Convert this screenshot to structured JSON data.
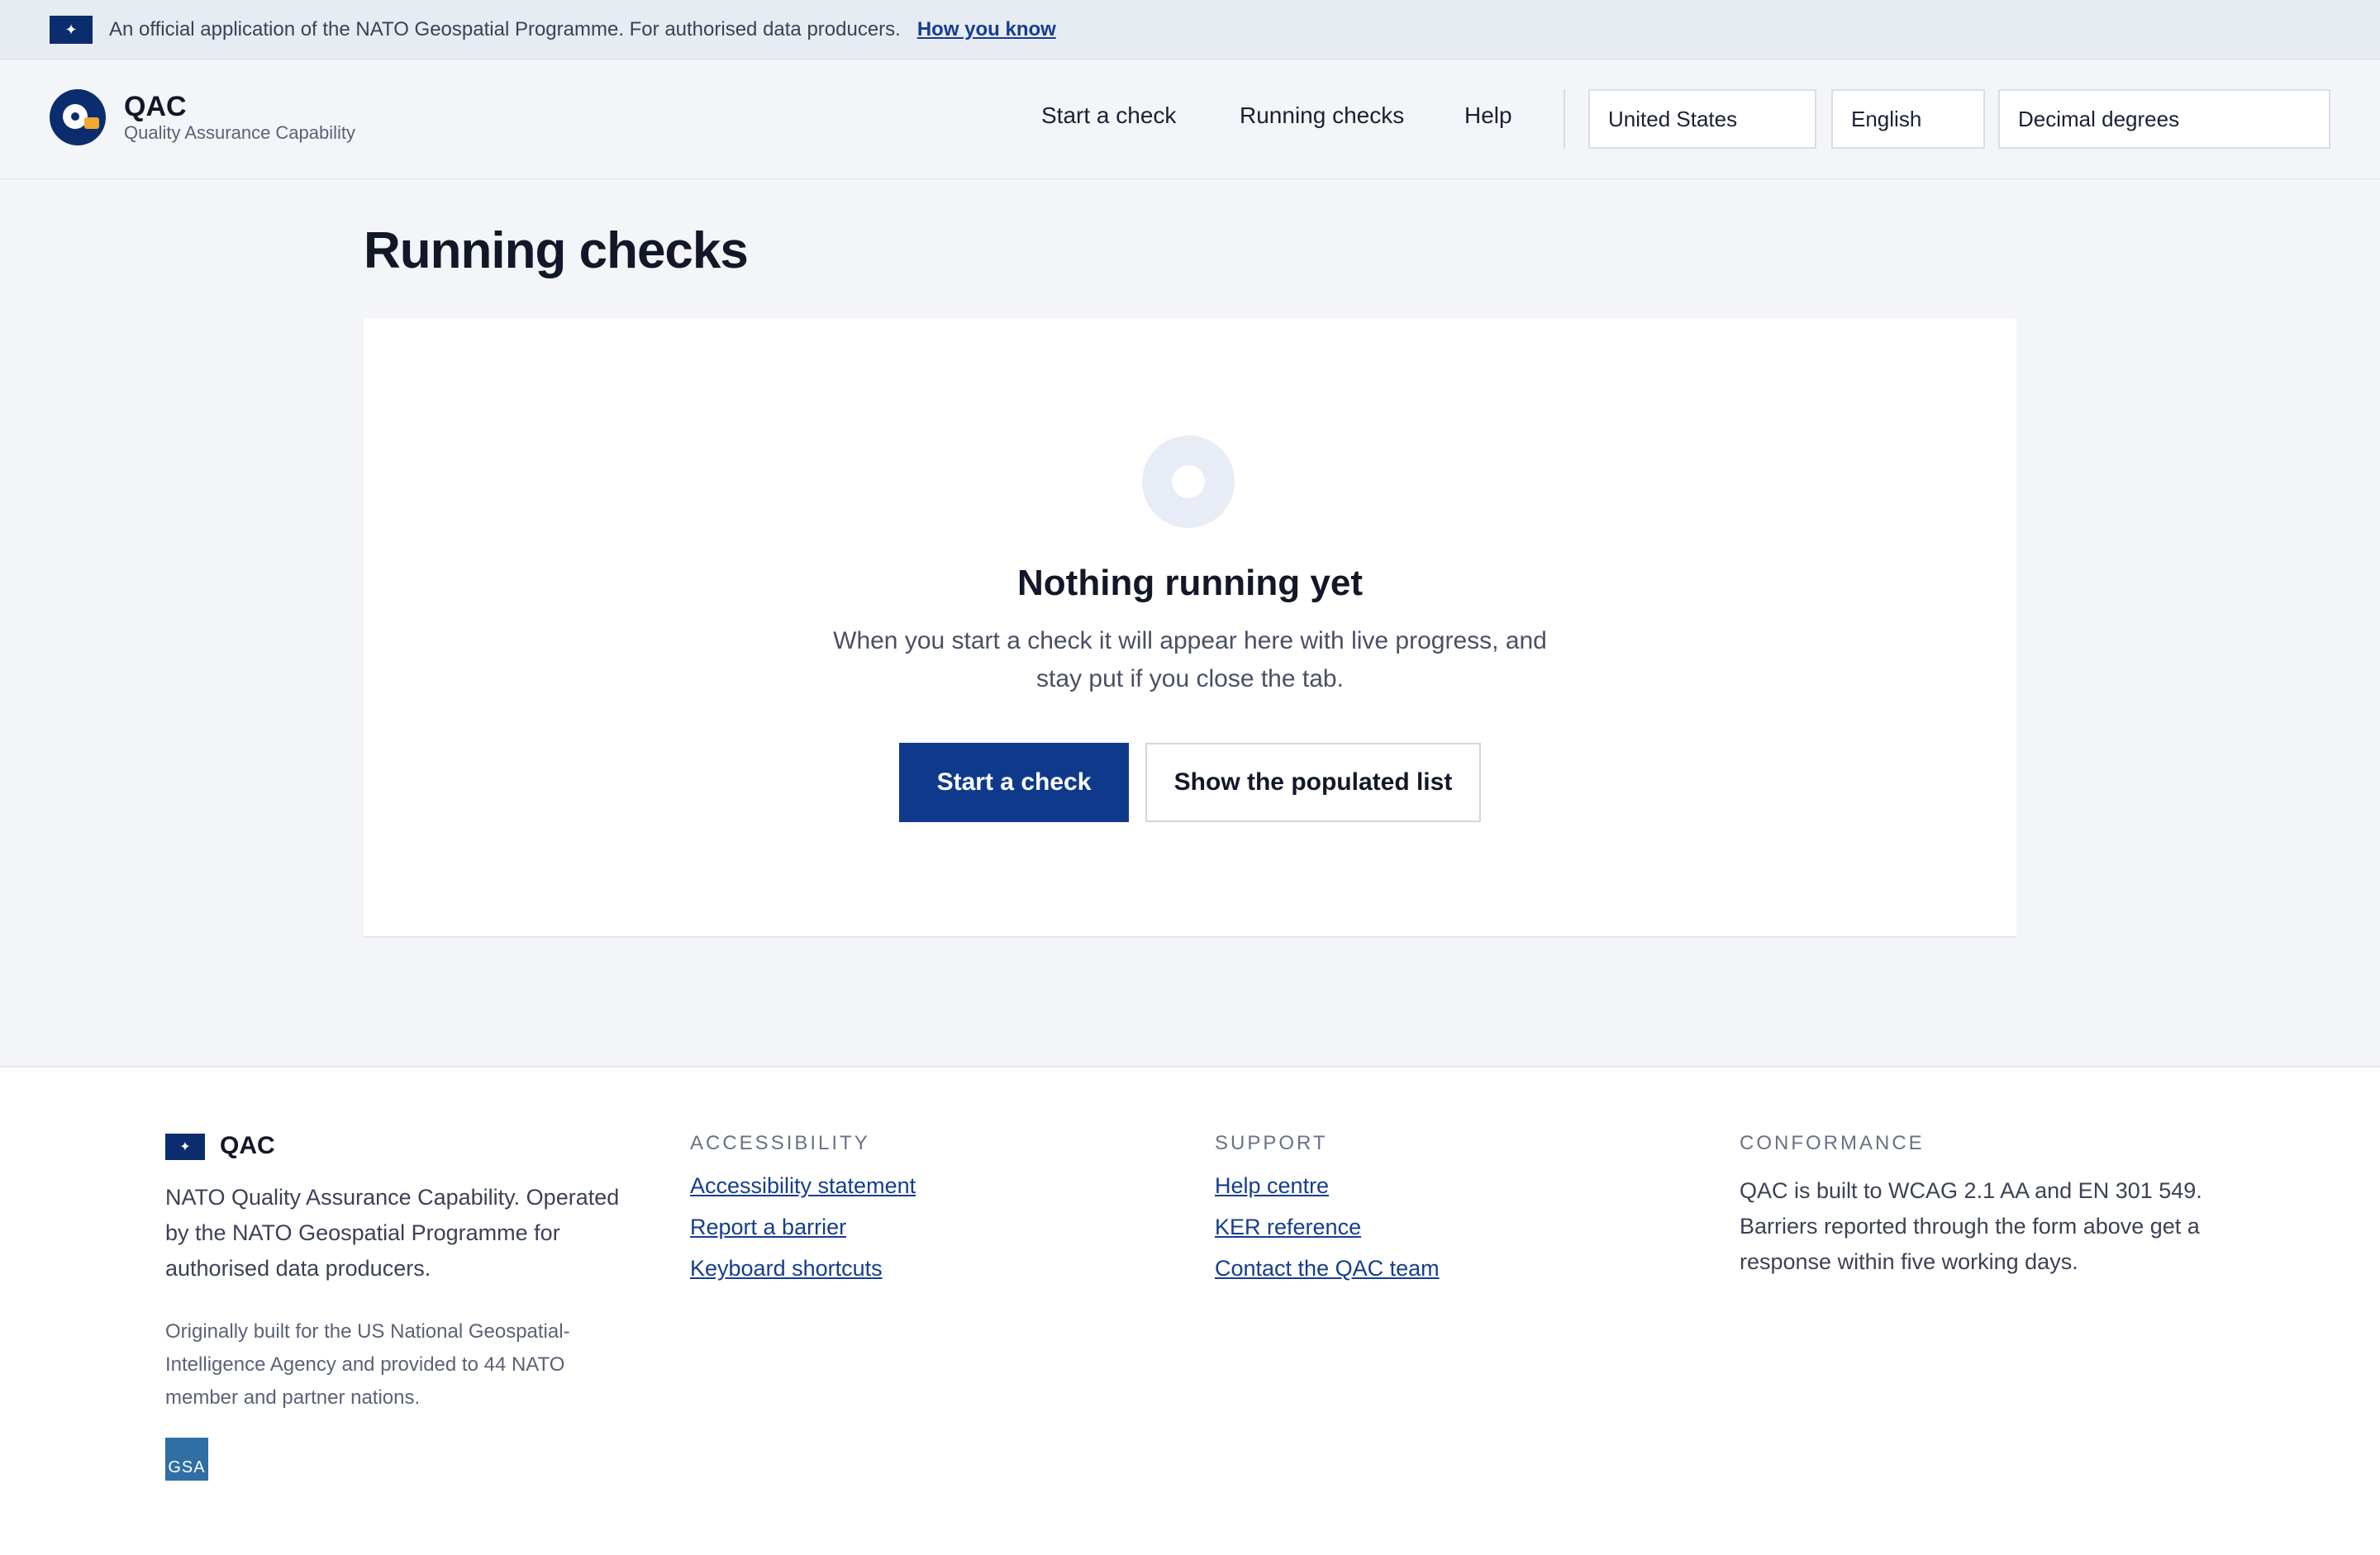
{
  "official_banner": {
    "flag_glyph": "✦",
    "text": "An official application of the NATO Geospatial Programme. For authorised data producers.",
    "link": "How you know"
  },
  "header": {
    "logo_title": "QAC",
    "logo_subtitle": "Quality Assurance Capability",
    "nav": [
      {
        "label": "Start a check"
      },
      {
        "label": "Running checks"
      },
      {
        "label": "Help"
      }
    ],
    "country": "United States",
    "language": "English",
    "coordinate_format": "Decimal degrees"
  },
  "main": {
    "page_title": "Running checks",
    "empty_state": {
      "icon": "empty-ring-icon",
      "heading": "Nothing running yet",
      "description": "When you start a check it will appear here with live progress, and stay put if you close the tab.",
      "primary_button": "Start a check",
      "secondary_button": "Show the populated list"
    }
  },
  "footer": {
    "flag_glyph": "✦",
    "brand": "QAC",
    "about": "NATO Quality Assurance Capability. Operated by the NATO Geospatial Programme for authorised data producers.",
    "origin": "Originally built for the US National Geospatial-Intelligence Agency and provided to 44 NATO member and partner nations.",
    "badge": "GSA",
    "accessibility": {
      "heading": "ACCESSIBILITY",
      "links": [
        "Accessibility statement",
        "Report a barrier",
        "Keyboard shortcuts"
      ]
    },
    "support": {
      "heading": "SUPPORT",
      "links": [
        "Help centre",
        "KER reference",
        "Contact the QAC team"
      ]
    },
    "conformance": {
      "heading": "CONFORMANCE",
      "text": "QAC is built to WCAG 2.1 AA and EN 301 549. Barriers reported through the form above get a response within five working days."
    }
  },
  "colors": {
    "primary": "#0f3a8c",
    "brand_navy": "#0b2d6e",
    "link": "#163d8f",
    "page_bg": "#f3f5f9"
  }
}
